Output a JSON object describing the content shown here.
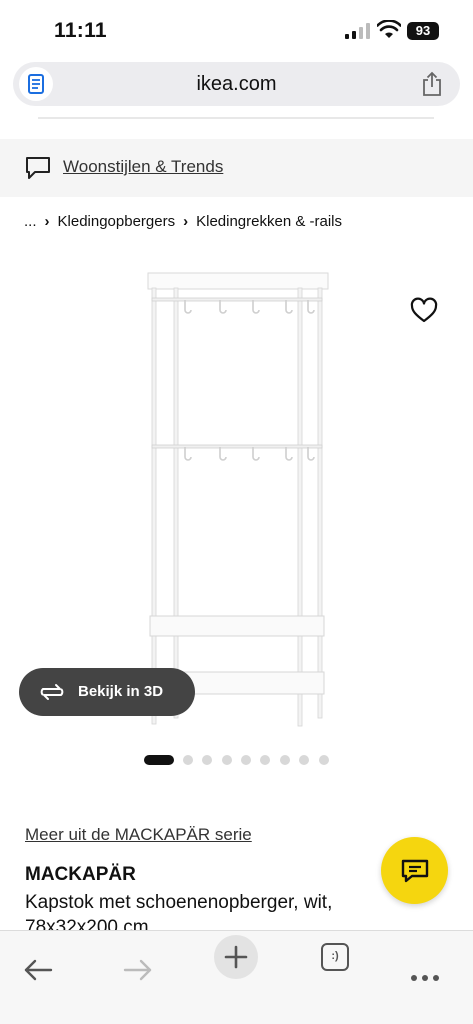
{
  "status_bar": {
    "time": "11:11",
    "battery": "93"
  },
  "browser": {
    "url": "ikea.com"
  },
  "banner": {
    "link_text": "Woonstijlen & Trends"
  },
  "breadcrumb": {
    "items": [
      "...",
      "Kledingopbergers",
      "Kledingrekken & -rails"
    ]
  },
  "gallery": {
    "view_3d_label": "Bekijk in 3D",
    "image_count": 9,
    "active_index": 0
  },
  "product": {
    "series_link": "Meer uit de MACKAPÄR serie",
    "name": "MACKAPÄR",
    "description": "Kapstok met schoenenopberger, wit, 78x32x200 cm"
  },
  "colors": {
    "chat_fab": "#f5d60f",
    "view_3d_bg": "#444444",
    "banner_bg": "#f5f5f5"
  },
  "icons": {
    "reader": "reader-icon",
    "share": "share-icon",
    "chat": "chat-icon",
    "favourite": "heart-icon",
    "rotate_3d": "rotate-3d-icon"
  }
}
